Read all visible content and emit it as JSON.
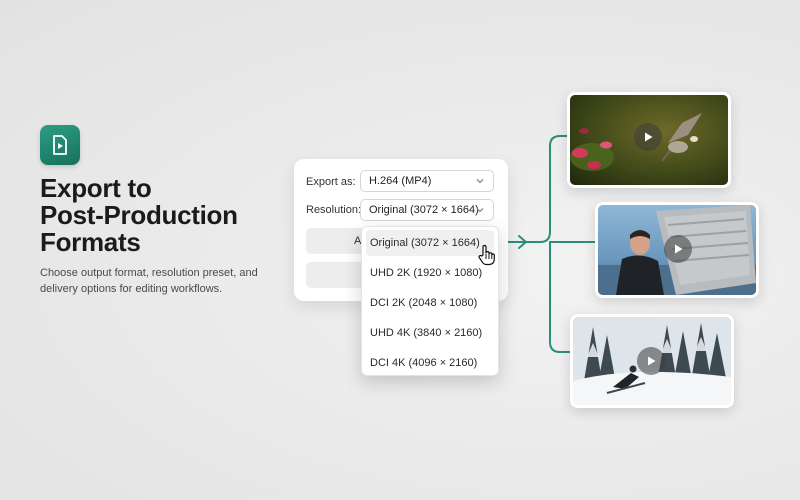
{
  "hero": {
    "title_line1": "Export to",
    "title_line2": "Post-Production",
    "title_line3": "Formats",
    "description": "Choose output format, resolution preset, and delivery options for editing workflows."
  },
  "export_panel": {
    "export_as_label": "Export as:",
    "export_as_value": "H.264 (MP4)",
    "resolution_label": "Resolution:",
    "resolution_value": "Original (3072 × 1664)",
    "primary_button_partial": "A"
  },
  "resolution_dropdown": {
    "options": [
      {
        "label": "Original (3072 × 1664)",
        "selected": true
      },
      {
        "label": "UHD 2K (1920 × 1080)",
        "selected": false
      },
      {
        "label": "DCI 2K (2048 × 1080)",
        "selected": false
      },
      {
        "label": "UHD 4K (3840 × 2160)",
        "selected": false
      },
      {
        "label": "DCI 4K (4096 × 2160)",
        "selected": false
      }
    ]
  },
  "colors": {
    "accent": "#1f8a72",
    "connector": "#2a8f78"
  },
  "icons": {
    "app": "video-file-icon",
    "chevron": "chevron-down-icon",
    "cursor": "hand-pointer-icon",
    "play": "play-icon"
  },
  "thumbnails": [
    {
      "name": "hummingbird-clip"
    },
    {
      "name": "person-suitcase-clip"
    },
    {
      "name": "snow-skier-clip"
    }
  ]
}
